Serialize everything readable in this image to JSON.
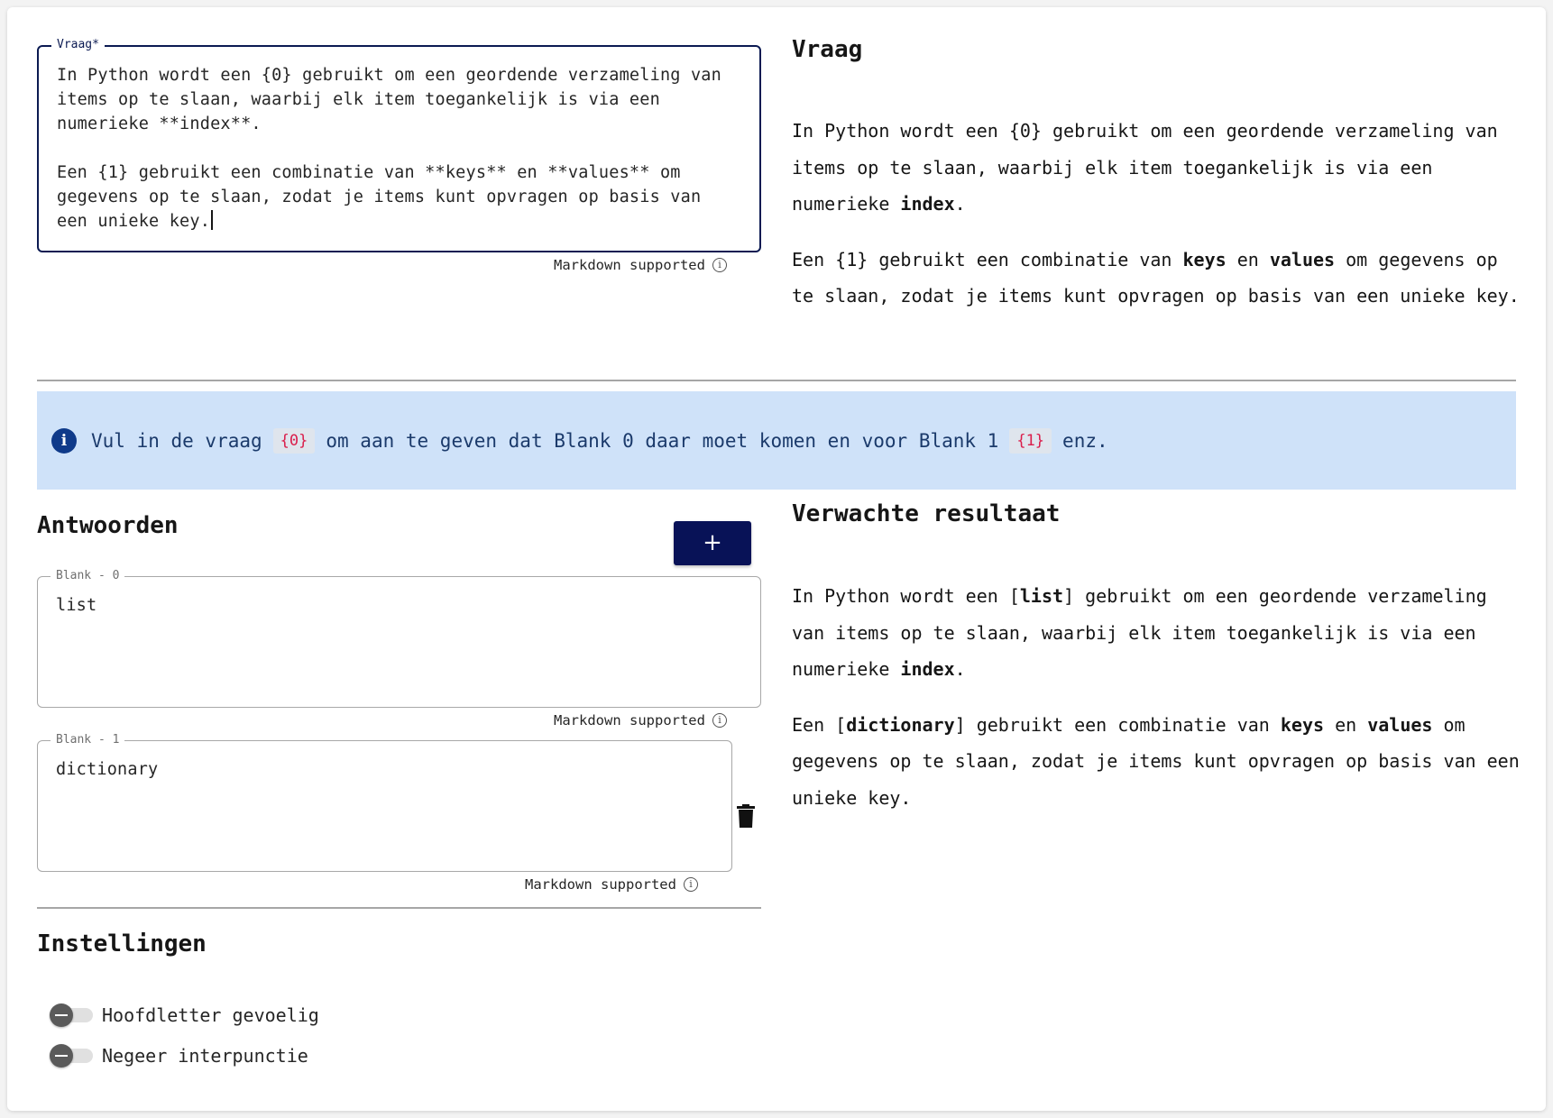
{
  "question_field": {
    "legend": "Vraag*",
    "paragraph_1": "In Python wordt een {0} gebruikt om een geordende verzameling van\nitems op te slaan, waarbij elk item toegankelijk is via een\nnumerieke **index**.",
    "paragraph_2": "Een {1} gebruikt een combinatie van **keys** en **values** om\ngegevens op te slaan, zodat je items kunt opvragen op basis van\neen unieke key.",
    "helper": "Markdown supported"
  },
  "question_preview": {
    "heading": "Vraag",
    "p1": {
      "t1": "In Python wordt een {0} gebruikt om een geordende verzameling van items op te slaan, waarbij elk item toegankelijk is via een numerieke ",
      "b1": "index",
      "t2": "."
    },
    "p2": {
      "t1": "Een {1} gebruikt een combinatie van ",
      "b1": "keys",
      "t2": " en ",
      "b2": "values",
      "t3": " om gegevens op te slaan, zodat je items kunt opvragen op basis van een unieke key."
    }
  },
  "banner": {
    "text_1": "Vul in de vraag",
    "code_1": "{0}",
    "text_2": "om aan te geven dat Blank 0 daar moet komen en voor Blank 1",
    "code_2": "{1}",
    "text_3": "enz."
  },
  "answers": {
    "heading": "Antwoorden",
    "add_label": "+",
    "blanks": [
      {
        "legend": "Blank - 0",
        "value": "list",
        "helper": "Markdown supported"
      },
      {
        "legend": "Blank - 1",
        "value": "dictionary",
        "helper": "Markdown supported"
      }
    ]
  },
  "result_preview": {
    "heading": "Verwachte resultaat",
    "p1": {
      "t1": "In Python wordt een [",
      "b1": "list",
      "t2": "] gebruikt om een geordende verzameling van items op te slaan, waarbij elk item toegankelijk is via een numerieke ",
      "b2": "index",
      "t3": "."
    },
    "p2": {
      "t1": "Een [",
      "b1": "dictionary",
      "t2": "] gebruikt een combinatie van ",
      "b2": "keys",
      "t3": " en ",
      "b3": "values",
      "t4": " om gegevens op te slaan, zodat je items kunt opvragen op basis van een unieke key."
    }
  },
  "settings": {
    "heading": "Instellingen",
    "toggles": [
      {
        "label": "Hoofdletter gevoelig",
        "checked": false
      },
      {
        "label": "Negeer interpunctie",
        "checked": false
      }
    ]
  },
  "colors": {
    "primary": "#081257",
    "banner_bg": "#cfe2f9",
    "banner_text": "#1b3a6b",
    "code_chip": "#da1e4b"
  }
}
